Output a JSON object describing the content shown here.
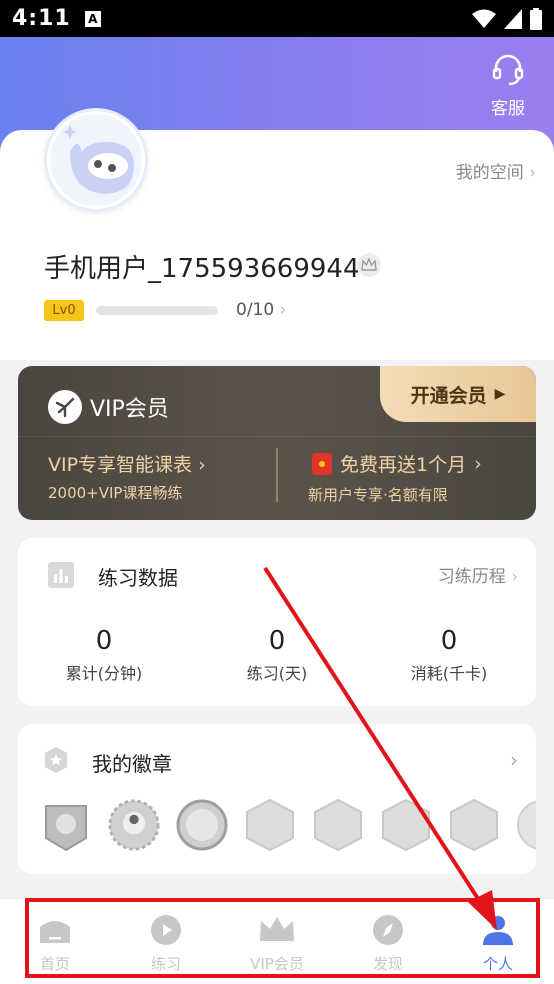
{
  "status": {
    "time": "4:11",
    "badge": "A"
  },
  "header": {
    "service_label": "客服"
  },
  "profile": {
    "space_link": "我的空间",
    "username": "手机用户_175593669944",
    "level": "Lv0",
    "level_progress": "0/10"
  },
  "vip": {
    "title": "VIP会员",
    "open_button": "开通会员",
    "feature1": "VIP专享智能课表",
    "feature1_sub": "2000+VIP课程畅练",
    "feature2": "免费再送1个月",
    "feature2_sub": "新用户专享·名额有限"
  },
  "stats": {
    "title": "练习数据",
    "history_link": "习练历程",
    "items": [
      {
        "value": "0",
        "label": "累计(分钟)"
      },
      {
        "value": "0",
        "label": "练习(天)"
      },
      {
        "value": "0",
        "label": "消耗(千卡)"
      }
    ]
  },
  "badges": {
    "title": "我的徽章"
  },
  "tabs": [
    {
      "label": "首页"
    },
    {
      "label": "练习"
    },
    {
      "label": "VIP会员"
    },
    {
      "label": "发现"
    },
    {
      "label": "个人"
    }
  ],
  "colors": {
    "accent": "#4f74e6",
    "annotation": "#e3131a",
    "vip_gold": "#f0d2a4"
  }
}
